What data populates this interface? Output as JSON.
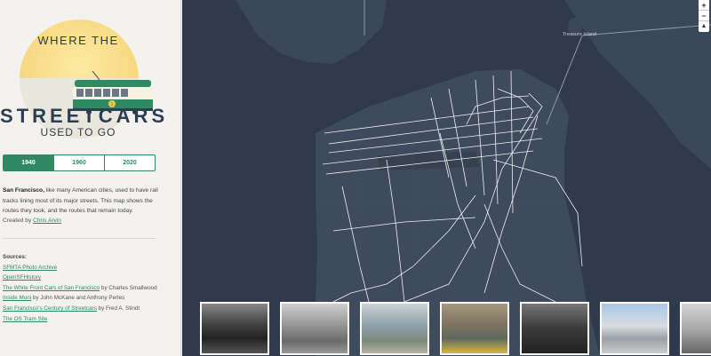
{
  "sidebar": {
    "logo": {
      "title_top": "WHERE THE",
      "title_main": "STREETCARS",
      "title_sub": "USED TO GO",
      "streetcar_badge": "1"
    },
    "year_tabs": [
      {
        "label": "1940",
        "active": true
      },
      {
        "label": "1960",
        "active": false
      },
      {
        "label": "2020",
        "active": false
      }
    ],
    "intro": {
      "bold": "San Francisco,",
      "text": " like many American cities, used to have rail tracks lining most of its major streets. This map shows the routes they took, and the routes that remain today."
    },
    "credit": {
      "prefix": "Created by ",
      "author": "Chris Arvin"
    },
    "sources": {
      "title": "Sources:",
      "items": [
        {
          "link": "SFMTA Photo Archive",
          "suffix": ""
        },
        {
          "link": "OpenSFHistory",
          "suffix": ""
        },
        {
          "link": "The White Front Cars of San Francisco",
          "suffix": " by Charles Smallwood"
        },
        {
          "link": "Inside Muni",
          "suffix": " by John McKane and Anthony Perles"
        },
        {
          "link": "San Francisco's Century of Streetcars",
          "suffix": " by Fred A. Stindt"
        },
        {
          "link": "The OS Tram Site",
          "suffix": ""
        }
      ]
    }
  },
  "map": {
    "label": "Treasure Island",
    "zoom_in": "+",
    "zoom_out": "−",
    "compass": "▲"
  },
  "colors": {
    "accent": "#2f8a63",
    "map_land": "#3d4a5c",
    "map_water": "#2f3b4d",
    "routes": "#ffffff"
  },
  "photos": [
    {
      "name": "photo-crowd"
    },
    {
      "name": "photo-ferry-building"
    },
    {
      "name": "photo-downtown-streetcar"
    },
    {
      "name": "photo-street-yellow-car"
    },
    {
      "name": "photo-tunnel-streetcar"
    },
    {
      "name": "photo-avenue-streetcar"
    },
    {
      "name": "photo-partial"
    }
  ]
}
